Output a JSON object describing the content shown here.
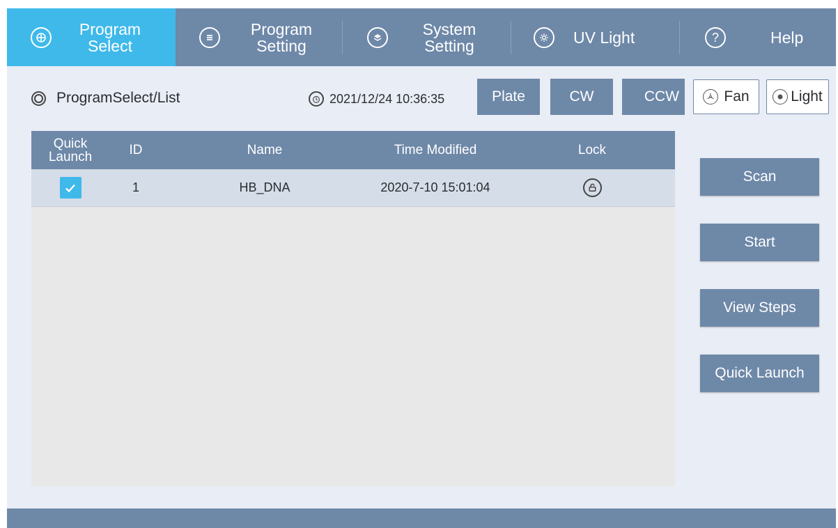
{
  "nav": {
    "items": [
      {
        "label": "Program\nSelect",
        "icon": "grid-circle-icon",
        "active": true
      },
      {
        "label": "Program\nSetting",
        "icon": "list-circle-icon",
        "active": false
      },
      {
        "label": "System\nSetting",
        "icon": "layers-circle-icon",
        "active": false
      },
      {
        "label": "UV Light",
        "icon": "sun-circle-icon",
        "active": false
      },
      {
        "label": "Help",
        "icon": "question-circle-icon",
        "active": false
      }
    ]
  },
  "breadcrumb": "ProgramSelect/List",
  "datetime": "2021/12/24 10:36:35",
  "toolbar": {
    "plate": "Plate",
    "cw": "CW",
    "ccw": "CCW",
    "fan": "Fan",
    "light": "Light"
  },
  "table": {
    "headers": {
      "quick_launch": "Quick\nLaunch",
      "id": "ID",
      "name": "Name",
      "time_modified": "Time Modified",
      "lock": "Lock"
    },
    "rows": [
      {
        "quick_launch": true,
        "id": "1",
        "name": "HB_DNA",
        "time_modified": "2020-7-10 15:01:04",
        "locked": false
      }
    ]
  },
  "actions": {
    "scan": "Scan",
    "start": "Start",
    "view_steps": "View Steps",
    "quick_launch": "Quick Launch"
  },
  "colors": {
    "primary": "#6e88a8",
    "active": "#3fb9ea",
    "background": "#e9edf5"
  }
}
